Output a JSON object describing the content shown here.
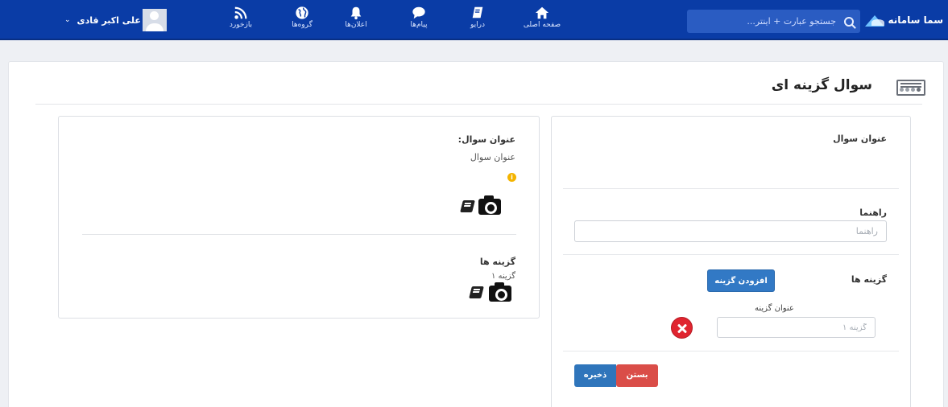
{
  "navbar": {
    "brand": "سما سامانه",
    "search": {
      "placeholder": "جستجو عبارت + اینتر..."
    },
    "items": [
      {
        "label": "صفحه اصلی",
        "icon": "home-icon"
      },
      {
        "label": "درایو",
        "icon": "drive-icon"
      },
      {
        "label": "پیام‌ها",
        "icon": "messages-icon"
      },
      {
        "label": "اعلان‌ها",
        "icon": "notifications-icon"
      },
      {
        "label": "گروه‌ها",
        "icon": "globe-icon"
      },
      {
        "label": "بازخورد",
        "icon": "rss-icon"
      }
    ],
    "user": {
      "name": "علی اکبر قادی",
      "icon": "chevron-down-icon"
    }
  },
  "page": {
    "title": "سوال گزینه ای"
  },
  "form": {
    "question_title_label": "عنوان سوال",
    "guide_label": "راهنما",
    "guide_placeholder": "راهنما",
    "options_label": "گزینه ها",
    "add_option_label": "افزودن گزینه",
    "option_title_label": "عنوان گزینه",
    "option_placeholder": "گزینه ۱",
    "close_label": "بستن",
    "save_label": "ذخیره"
  },
  "preview": {
    "question_title_label": "عنوان سوال:",
    "question_title_value": "عنوان سوال",
    "info_glyph": "i",
    "options_label": "گزینه ها",
    "option_1": "گزینه ۱"
  },
  "colors": {
    "navbar": "#0a3ca6",
    "primary_button": "#3279c5",
    "danger_button": "#da4d48",
    "remove_icon": "#e0242f",
    "info_icon": "#f4b400"
  }
}
